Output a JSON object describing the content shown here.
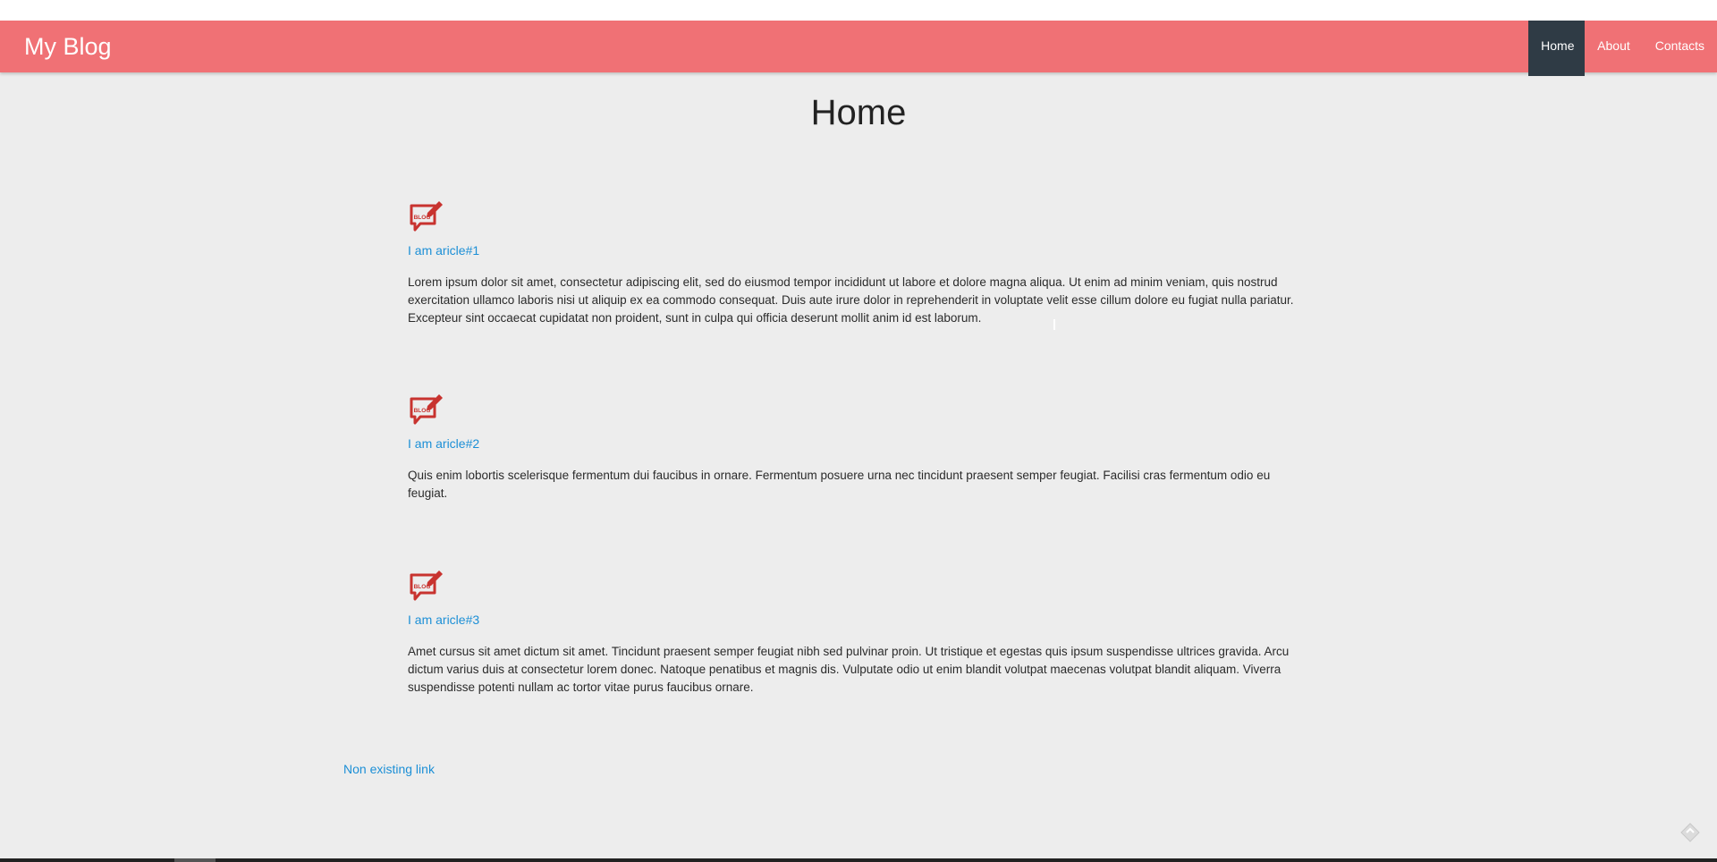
{
  "header": {
    "brand": "My Blog",
    "nav": [
      {
        "label": "Home",
        "active": true
      },
      {
        "label": "About",
        "active": false
      },
      {
        "label": "Contacts",
        "active": false
      }
    ]
  },
  "page_title": "Home",
  "articles": [
    {
      "icon": "blog-speech-bubble-pencil-icon",
      "icon_text": "BLOG",
      "title": "I am aricle#1",
      "body": "Lorem ipsum dolor sit amet, consectetur adipiscing elit, sed do eiusmod tempor incididunt ut labore et dolore magna aliqua. Ut enim ad minim veniam, quis nostrud exercitation ullamco laboris nisi ut aliquip ex ea commodo consequat. Duis aute irure dolor in reprehenderit in voluptate velit esse cillum dolore eu fugiat nulla pariatur. Excepteur sint occaecat cupidatat non proident, sunt in culpa qui officia deserunt mollit anim id est laborum."
    },
    {
      "icon": "blog-speech-bubble-pencil-icon",
      "icon_text": "BLOG",
      "title": "I am aricle#2",
      "body": "Quis enim lobortis scelerisque fermentum dui faucibus in ornare. Fermentum posuere urna nec tincidunt praesent semper feugiat. Facilisi cras fermentum odio eu feugiat."
    },
    {
      "icon": "blog-speech-bubble-pencil-icon",
      "icon_text": "BLOG",
      "title": "I am aricle#3",
      "body": "Amet cursus sit amet dictum sit amet. Tincidunt praesent semper feugiat nibh sed pulvinar proin. Ut tristique et egestas quis ipsum suspendisse ultrices gravida. Arcu dictum varius duis at consectetur lorem donec. Natoque penatibus et magnis dis. Vulputate odio ut enim blandit volutpat maecenas volutpat blandit aliquam. Viverra suspendisse potenti nullam ac tortor vitae purus faucibus ornare."
    }
  ],
  "footer_link": "Non existing link",
  "colors": {
    "navbar": "#f07175",
    "nav_active": "#2f3b45",
    "link": "#1c8fd6",
    "icon": "#c8332f",
    "background": "#ededed"
  }
}
